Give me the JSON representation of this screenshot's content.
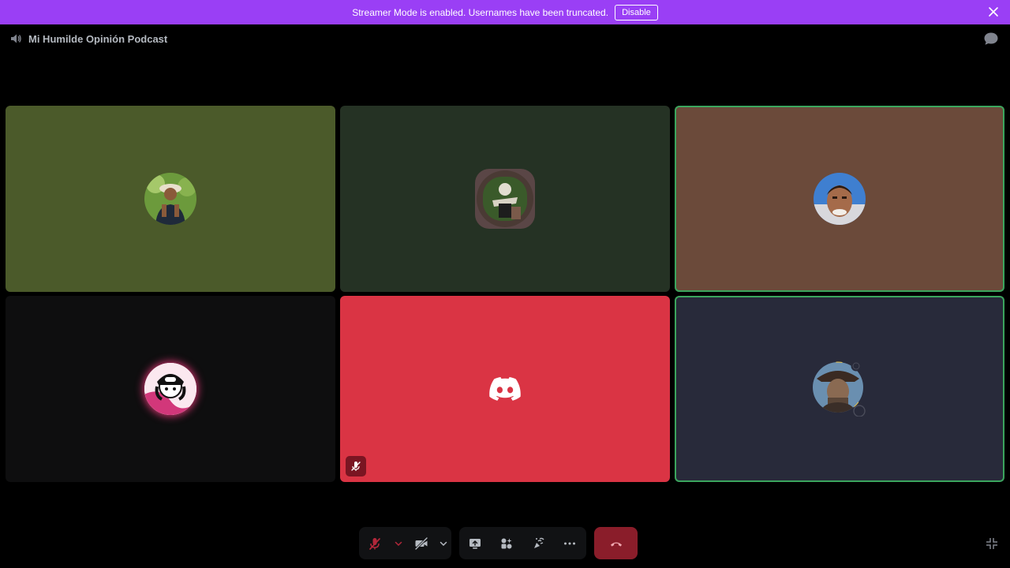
{
  "notice": {
    "text": "Streamer Mode is enabled. Usernames have been truncated.",
    "disable_label": "Disable"
  },
  "channel": {
    "name": "Mi Humilde Opinión Podcast"
  },
  "tiles": [
    {
      "background": "#4b5a2a",
      "speaking": false
    },
    {
      "background": "#253224",
      "speaking": false
    },
    {
      "background": "#6b4a3a",
      "speaking": true
    },
    {
      "background": "#0e0e0f",
      "speaking": false
    },
    {
      "background": "#da3444",
      "speaking": false,
      "muted": true
    },
    {
      "background": "#282a3a",
      "speaking": true
    }
  ],
  "colors": {
    "accent": "#9a3ff5",
    "speaking_ring": "#3ba55d",
    "end_call": "#8a1d2a",
    "discord_red": "#da3444"
  },
  "icons": {
    "speaker": "speaker-icon",
    "chat": "chat-bubble-icon",
    "close": "close-icon",
    "mic_off": "mic-off-icon",
    "camera_off": "camera-off-icon",
    "screen_share": "screen-share-icon",
    "activities": "activities-icon",
    "soundboard": "soundboard-icon",
    "more": "more-icon",
    "hang_up": "hang-up-icon",
    "exit_fullscreen": "exit-fullscreen-icon"
  }
}
